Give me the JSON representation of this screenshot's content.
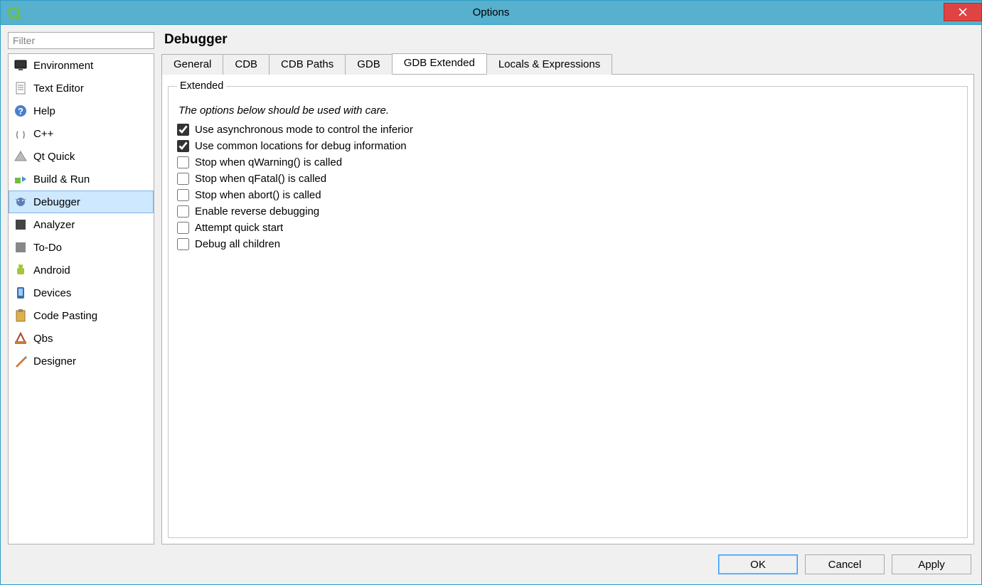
{
  "window": {
    "title": "Options"
  },
  "filter": {
    "placeholder": "Filter"
  },
  "categories": [
    {
      "label": "Environment",
      "icon": "monitor"
    },
    {
      "label": "Text Editor",
      "icon": "doc"
    },
    {
      "label": "Help",
      "icon": "help"
    },
    {
      "label": "C++",
      "icon": "cpp"
    },
    {
      "label": "Qt Quick",
      "icon": "qquick"
    },
    {
      "label": "Build & Run",
      "icon": "buildrun"
    },
    {
      "label": "Debugger",
      "icon": "debugger",
      "selected": true
    },
    {
      "label": "Analyzer",
      "icon": "analyzer"
    },
    {
      "label": "To-Do",
      "icon": "todo"
    },
    {
      "label": "Android",
      "icon": "android"
    },
    {
      "label": "Devices",
      "icon": "devices"
    },
    {
      "label": "Code Pasting",
      "icon": "paste"
    },
    {
      "label": "Qbs",
      "icon": "qbs"
    },
    {
      "label": "Designer",
      "icon": "designer"
    }
  ],
  "page": {
    "title": "Debugger"
  },
  "tabs": [
    {
      "label": "General"
    },
    {
      "label": "CDB"
    },
    {
      "label": "CDB Paths"
    },
    {
      "label": "GDB"
    },
    {
      "label": "GDB Extended",
      "active": true
    },
    {
      "label": "Locals & Expressions"
    }
  ],
  "group": {
    "legend": "Extended",
    "hint": "The options below should be used with care.",
    "checks": [
      {
        "label": "Use asynchronous mode to control the inferior",
        "checked": true
      },
      {
        "label": "Use common locations for debug information",
        "checked": true
      },
      {
        "label": "Stop when qWarning() is called",
        "checked": false
      },
      {
        "label": "Stop when qFatal() is called",
        "checked": false
      },
      {
        "label": "Stop when abort() is called",
        "checked": false
      },
      {
        "label": "Enable reverse debugging",
        "checked": false
      },
      {
        "label": "Attempt quick start",
        "checked": false
      },
      {
        "label": "Debug all children",
        "checked": false
      }
    ]
  },
  "buttons": {
    "ok": "OK",
    "cancel": "Cancel",
    "apply": "Apply"
  }
}
